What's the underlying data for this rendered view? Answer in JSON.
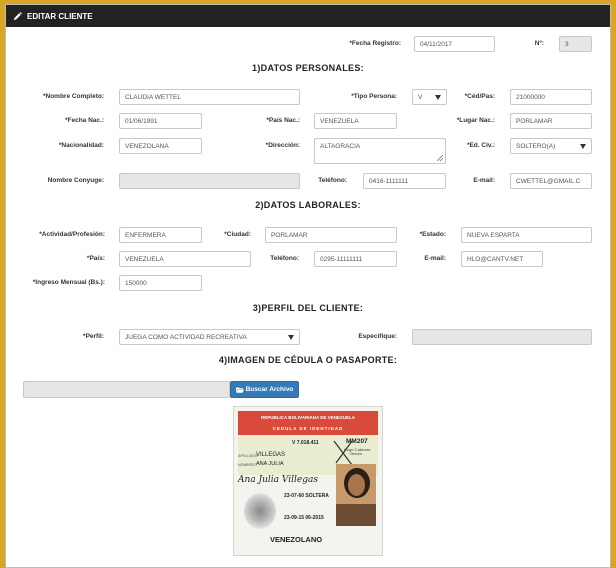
{
  "header": {
    "title": "EDITAR CLIENTE",
    "icon": "pencil-icon"
  },
  "registro": {
    "fecha_label": "*Fecha Registro:",
    "fecha_value": "04/11/2017",
    "numero_label": "Nº:",
    "numero_value": "3"
  },
  "sections": {
    "personales": "1)DATOS PERSONALES:",
    "laborales": "2)DATOS LABORALES:",
    "perfil": "3)PERFIL DEL CLIENTE:",
    "imagen": "4)IMAGEN DE CÉDULA O PASAPORTE:"
  },
  "personales": {
    "nombre_label": "*Nombre Completo:",
    "nombre_value": "CLAUDIA WETTEL",
    "tipo_label": "*Tipo Persona:",
    "tipo_value": "V",
    "ced_label": "*Céd/Pas:",
    "ced_value": "21000000",
    "fecha_nac_label": "*Fecha Nac.:",
    "fecha_nac_value": "01/06/1991",
    "pais_nac_label": "*País Nac.:",
    "pais_nac_value": "VENEZUELA",
    "lugar_nac_label": "*Lugar Nac.:",
    "lugar_nac_value": "PORLAMAR",
    "nacionalidad_label": "*Nacionalidad:",
    "nacionalidad_value": "VENEZOLANA",
    "direccion_label": "*Dirección:",
    "direccion_value": "ALTAGRACIA",
    "edo_civ_label": "*Ed. Civ.:",
    "edo_civ_value": "SOLTERO(A)",
    "conyuge_label": "Nombre Conyuge:",
    "conyuge_value": "",
    "telefono_label": "Teléfono:",
    "telefono_value": "0416-1111111",
    "email_label": "E-mail:",
    "email_value": "CWETTEL@GMAIL.C"
  },
  "laborales": {
    "actividad_label": "*Actividad/Profesión:",
    "actividad_value": "ENFERMERA",
    "ciudad_label": "*Ciudad:",
    "ciudad_value": "PORLAMAR",
    "estado_label": "*Estado:",
    "estado_value": "NUEVA ESPARTA",
    "pais_label": "*País:",
    "pais_value": "VENEZUELA",
    "telefono_label": "Teléfono:",
    "telefono_value": "0295-11111111",
    "email_label": "E-mail:",
    "email_value": "HLO@CANTV.NET",
    "ingreso_label": "*Ingreso Mensual (Bs.):",
    "ingreso_value": "150000"
  },
  "perfil": {
    "perfil_label": "*Perfil:",
    "perfil_value": "JUEGA COMO ACTIVIDAD RECREATIVA",
    "especifique_label": "Especifique:",
    "especifique_value": ""
  },
  "imagen": {
    "file_value": "",
    "button_label": "Buscar Archivo",
    "button_icon": "folder-open-icon"
  },
  "cedula": {
    "header1": "REPUBLICA BOLIVARIANA DE VENEZUELA",
    "header2": "CEDULA DE IDENTIDAD",
    "numero": "V 7.018.411",
    "code": "MM207",
    "director": "Hugo Cabezas",
    "director_title": "Director",
    "apellidos_lbl": "APELLIDOS",
    "apellidos": "VILLEGAS",
    "nombres_lbl": "NOMBRES",
    "nombres": "ANA JULIA",
    "signature": "Ana Julia Villegas",
    "f_nac": "23-07-60 SOLTERA",
    "f_exp": "23-09-15 06-2015",
    "country": "VENEZOLANO"
  },
  "colors": {
    "accent": "#d8a623",
    "header": "#222222",
    "button": "#337ab7"
  }
}
